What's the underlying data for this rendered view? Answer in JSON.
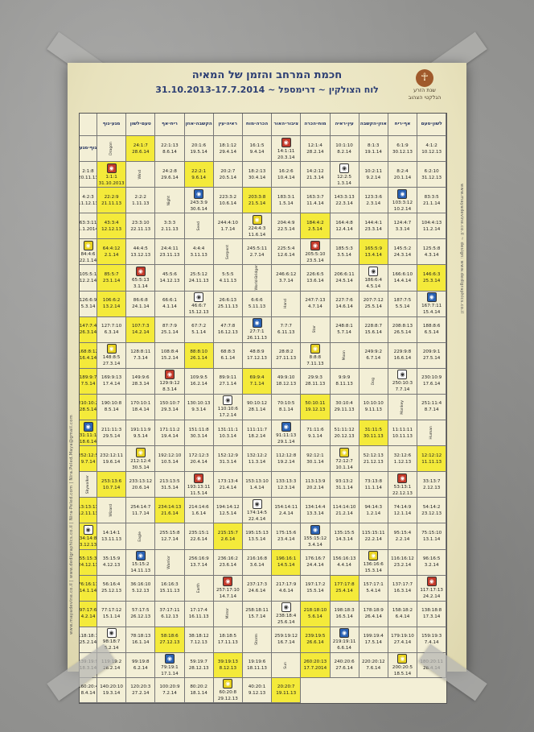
{
  "poster": {
    "title": "חכמת המרחב והזמן של המאיה",
    "subtitle": "לוח הצולקין ~ דרימספל ~ 31.10.2013-17.7.2014",
    "date_range": "31.10.2013-17.7.2014",
    "logo": {
      "line1": "שנת הזרע",
      "line2": "הגלקטי הצהוב"
    },
    "side_left": "www.mayadevine.co.il | www.dedigraphics.co.il | Nira-Peled.com | Nira.Peled.Maya@gmail.com",
    "side_right": "www.mayadevine.co.il ~ design: www.dedigraphics.co.il"
  },
  "columns": [
    "גוף-מגע",
    "לשון-טעם",
    "אף-ריח",
    "אוזן-הקשבה",
    "עין-ראיה",
    "מוח-הכרה",
    "ציבור-האור",
    "הכרה-מוח",
    "ראיה-עין",
    "הקשבה-אוזן",
    "ריח-אף",
    "טעם-לשון",
    "מגע-גוף"
  ],
  "rows": [
    {
      "label": "Dragon",
      "glyph": "#c43a2a",
      "cells": [
        "1:1:1|31.10.2013",
        "2:1:8|20.11.13",
        "4:1:2|10.12.13",
        "6:1:9|30.12.13",
        "8:1:3|19.1.14",
        "10:1:10|8.2.14",
        "12:1:4|28.2.14",
        "14:1:11|20.3.14",
        "16:1:5|9.4.14",
        "18:1:12|29.4.14",
        "20:1:6|19.5.14",
        "22:1:13|8.6.14",
        "24:1:7|28.6.14"
      ],
      "hl": [
        0,
        12
      ]
    },
    {
      "label": "Wind",
      "glyph": "#ffffff",
      "cells": [
        "2:2:2|1.11.13",
        "22:2:9|21.11.13",
        "4:2:3|11.12.13",
        "6:2:10|31.12.13",
        "8:2:4|20.1.14",
        "10:2:11|9.2.14",
        "12:2:5|1.3.14",
        "14:2:12|21.3.14",
        "16:2:6|10.4.14",
        "18:2:13|30.4.14",
        "20:2:7|20.5.14",
        "22:2:1|9.6.14",
        "24:2:8|29.6.14"
      ],
      "hl": [
        1,
        11
      ]
    },
    {
      "label": "Night",
      "glyph": "#2a62b4",
      "cells": [
        "3:3:3|2.11.13",
        "23:3:10|22.11.13",
        "43:3:4|12.12.13",
        "63:3:11|1.1.2014",
        "83:3:5|21.1.14",
        "103:3:12|10.2.14",
        "123:3:6|2.3.14",
        "143:3:13|22.3.14",
        "163:3:7|11.4.14",
        "183:3:1|1.5.14",
        "203:3:8|21.5.14",
        "223:3:2|10.6.14",
        "243:3:9|30.6.14"
      ],
      "hl": [
        2,
        10
      ]
    },
    {
      "label": "Seed",
      "glyph": "#e8d21e",
      "cells": [
        "4:4:4|3.11.13",
        "24:4:11|23.11.13",
        "44:4:5|13.12.13",
        "64:4:12|2.1.14",
        "84:4:6|22.1.14",
        "104:4:13|11.2.14",
        "124:4:7|3.3.14",
        "144:4:1|23.3.14",
        "164:4:8|12.4.14",
        "184:4:2|2.5.14",
        "204:4:9|22.5.14",
        "224:4:3|11.6.14",
        "244:4:10|1.7.14"
      ],
      "hl": [
        3,
        9
      ]
    },
    {
      "label": "Serpent",
      "glyph": "#c43a2a",
      "cells": [
        "5:5:5|4.11.13",
        "25:5:12|24.11.13",
        "45:5:6|14.12.13",
        "65:5:13|3.1.14",
        "85:5:7|23.1.14",
        "105:5:1|12.2.14",
        "125:5:8|4.3.14",
        "145:5:2|24.3.14",
        "165:5:9|13.4.14",
        "185:5:3|3.5.14",
        "205:5:10|23.5.14",
        "225:5:4|12.6.14",
        "245:5:11|2.7.14"
      ],
      "hl": [
        4,
        8
      ]
    },
    {
      "label": "World-Bridger",
      "glyph": "#ffffff",
      "cells": [
        "6:6:6|5.11.13",
        "26:6:13|25.11.13",
        "46:6:7|15.12.13",
        "66:6:1|4.1.14",
        "86:6:8|24.1.14",
        "106:6:2|13.2.14",
        "126:6:9|5.3.14",
        "146:6:3|25.3.14",
        "166:6:10|14.4.14",
        "186:6:4|4.5.14",
        "206:6:11|24.5.14",
        "226:6:5|13.6.14",
        "246:6:12|3.7.14"
      ],
      "hl": [
        5,
        7
      ]
    },
    {
      "label": "Hand",
      "glyph": "#2a62b4",
      "cells": [
        "7:7:7|6.11.13",
        "27:7:1|26.11.13",
        "47:7:8|16.12.13",
        "67:7:2|5.1.14",
        "87:7:9|25.1.14",
        "107:7:3|14.2.14",
        "127:7:10|6.3.14",
        "147:7:4|26.3.14",
        "167:7:11|15.4.14",
        "187:7:5|5.5.14",
        "207:7:12|25.5.14",
        "227:7:6|14.6.14",
        "247:7:13|4.7.14"
      ],
      "hl": [
        5,
        7
      ]
    },
    {
      "label": "Star",
      "glyph": "#e8d21e",
      "cells": [
        "8:8:8|7.11.13",
        "28:8:2|27.11.13",
        "48:8:9|17.12.13",
        "68:8:3|6.1.14",
        "88:8:10|26.1.14",
        "108:8:4|15.2.14",
        "128:8:11|7.3.14",
        "148:8:5|27.3.14",
        "168:8:12|16.4.14",
        "188:8:6|6.5.14",
        "208:8:13|26.5.14",
        "228:8:7|15.6.14",
        "248:8:1|5.7.14"
      ],
      "hl": [
        4,
        8
      ]
    },
    {
      "label": "Moon",
      "glyph": "#c43a2a",
      "cells": [
        "9:9:9|8.11.13",
        "29:9:3|28.11.13",
        "49:9:10|18.12.13",
        "69:9:4|7.1.14",
        "89:9:11|27.1.14",
        "109:9:5|16.2.14",
        "129:9:12|8.3.14",
        "149:9:6|28.3.14",
        "169:9:13|17.4.14",
        "189:9:7|7.5.14",
        "209:9:1|27.5.14",
        "229:9:8|16.6.14",
        "249:9:2|6.7.14"
      ],
      "hl": [
        3,
        9
      ]
    },
    {
      "label": "Dog",
      "glyph": "#ffffff",
      "cells": [
        "10:10:10|9.11.13",
        "30:10:4|29.11.13",
        "50:10:11|19.12.13",
        "70:10:5|8.1.14",
        "90:10:12|28.1.14",
        "110:10:6|17.2.14",
        "130:10:13|9.3.14",
        "150:10:7|29.3.14",
        "170:10:1|18.4.14",
        "190:10:8|8.5.14",
        "210:10:2|28.5.14",
        "230:10:9|17.6.14",
        "250:10:3|7.7.14"
      ],
      "hl": [
        2,
        10
      ]
    },
    {
      "label": "Monkey",
      "glyph": "#2a62b4",
      "cells": [
        "11:11:11|10.11.13",
        "31:11:5|30.11.13",
        "51:11:12|20.12.13",
        "71:11:6|9.1.14",
        "91:11:13|29.1.14",
        "111:11:7|18.2.14",
        "131:11:1|10.3.14",
        "151:11:8|30.3.14",
        "171:11:2|19.4.14",
        "191:11:9|9.5.14",
        "211:11:3|29.5.14",
        "231:11:10|18.6.14",
        "251:11:4|8.7.14"
      ],
      "hl": [
        1,
        11
      ]
    },
    {
      "label": "Human",
      "glyph": "#e8d21e",
      "cells": [
        "12:12:12|11.11.13",
        "32:12:6|1.12.13",
        "52:12:13|21.12.13",
        "72:12:7|10.1.14",
        "92:12:1|30.1.14",
        "112:12:8|19.2.14",
        "132:12:2|11.3.14",
        "152:12:9|31.3.14",
        "172:12:3|20.4.14",
        "192:12:10|10.5.14",
        "212:12:4|30.5.14",
        "232:12:11|19.6.14",
        "252:12:5|9.7.14"
      ],
      "hl": [
        0,
        12
      ]
    },
    {
      "label": "Skywalker",
      "glyph": "#c43a2a",
      "cells": [
        "13:13:13|12.11.13",
        "33:13:7|2.12.13",
        "53:13:1|22.12.13",
        "73:13:8|11.1.14",
        "93:13:2|31.1.14",
        "113:13:9|20.2.14",
        "133:13:3|12.3.14",
        "153:13:10|1.4.14",
        "173:13:4|21.4.14",
        "193:13:11|11.5.14",
        "213:13:5|31.5.14",
        "233:13:12|20.6.14",
        "253:13:6|10.7.14"
      ],
      "hl": [
        0,
        12
      ]
    },
    {
      "label": "Wizard",
      "glyph": "#ffffff",
      "cells": [
        "14:14:1|13.11.13",
        "34:14:8|3.12.13",
        "54:14:2|23.12.13",
        "74:14:9|12.1.14",
        "94:14:3|1.2.14",
        "114:14:10|21.2.14",
        "134:14:4|13.3.14",
        "154:14:11|2.4.14",
        "174:14:5|22.4.14",
        "194:14:12|12.5.14",
        "214:14:6|1.6.14",
        "234:14:13|21.6.14",
        "254:14:7|11.7.14"
      ],
      "hl": [
        1,
        11
      ]
    },
    {
      "label": "Eagle",
      "glyph": "#2a62b4",
      "cells": [
        "15:15:2|14.11.13",
        "35:15:9|4.12.13",
        "55:15:3|24.12.13",
        "75:15:10|13.1.14",
        "95:15:4|2.2.14",
        "115:15:11|22.2.14",
        "135:15:5|14.3.14",
        "155:15:12|3.4.14",
        "175:15:6|23.4.14",
        "195:15:13|13.5.14",
        "215:15:7|2.6.14",
        "235:15:1|22.6.14",
        "255:15:8|12.7.14"
      ],
      "hl": [
        2,
        10
      ]
    },
    {
      "label": "Warrior",
      "glyph": "#e8d21e",
      "cells": [
        "16:16:3|15.11.13",
        "36:16:10|5.12.13",
        "56:16:4|25.12.13",
        "76:16:11|14.1.14",
        "96:16:5|3.2.14",
        "116:16:12|23.2.14",
        "136:16:6|15.3.14",
        "156:16:13|4.4.14",
        "176:16:7|24.4.14",
        "196:16:1|14.5.14",
        "216:16:8|3.6.14",
        "236:16:2|23.6.14",
        "256:16:9|13.7.14"
      ],
      "hl": [
        3,
        9
      ]
    },
    {
      "label": "Earth",
      "glyph": "#c43a2a",
      "cells": [
        "17:17:4|16.11.13",
        "37:17:11|6.12.13",
        "57:17:5|26.12.13",
        "77:17:12|15.1.14",
        "97:17:6|4.2.14",
        "117:17:13|24.2.14",
        "137:17:7|16.3.14",
        "157:17:1|5.4.14",
        "177:17:8|25.4.14",
        "197:17:2|15.5.14",
        "217:17:9|4.6.14",
        "237:17:3|24.6.14",
        "257:17:10|14.7.14"
      ],
      "hl": [
        4,
        8
      ]
    },
    {
      "label": "Mirror",
      "glyph": "#ffffff",
      "cells": [
        "18:18:5|17.11.13",
        "38:18:12|7.12.13",
        "58:18:6|27.12.13",
        "78:18:13|16.1.14",
        "98:18:7|5.2.14",
        "118:18:1|25.2.14",
        "138:18:8|17.3.14",
        "158:18:2|6.4.14",
        "178:18:9|26.4.14",
        "198:18:3|16.5.14",
        "218:18:10|5.6.14",
        "238:18:4|25.6.14",
        "258:18:11|15.7.14"
      ],
      "hl": [
        2,
        10
      ]
    },
    {
      "label": "Storm",
      "glyph": "#2a62b4",
      "cells": [
        "19:19:6|18.11.13",
        "39:19:13|8.12.13",
        "59:19:7|28.12.13",
        "79:19:1|17.1.14",
        "99:19:8|6.2.14",
        "119:19:2|26.2.14",
        "139:19:9|18.3.14",
        "159:19:3|7.4.14",
        "179:19:10|27.4.14",
        "199:19:4|17.5.14",
        "219:19:11|6.6.14",
        "239:19:5|26.6.14",
        "259:19:12|16.7.14"
      ],
      "hl": [
        1,
        11
      ]
    },
    {
      "label": "Sun",
      "glyph": "#e8d21e",
      "cells": [
        "20:20:7|19.11.13",
        "40:20:1|9.12.13",
        "60:20:8|29.12.13",
        "80:20:2|18.1.14",
        "100:20:9|7.2.14",
        "120:20:3|27.2.14",
        "140:20:10|19.3.14",
        "160:20:4|8.4.14",
        "180:20:11|28.4.14",
        "200:20:5|18.5.14",
        "220:20:12|7.6.14",
        "240:20:6|27.6.14",
        "260:20:13|17.7.2014"
      ],
      "hl": [
        0,
        12
      ]
    }
  ]
}
